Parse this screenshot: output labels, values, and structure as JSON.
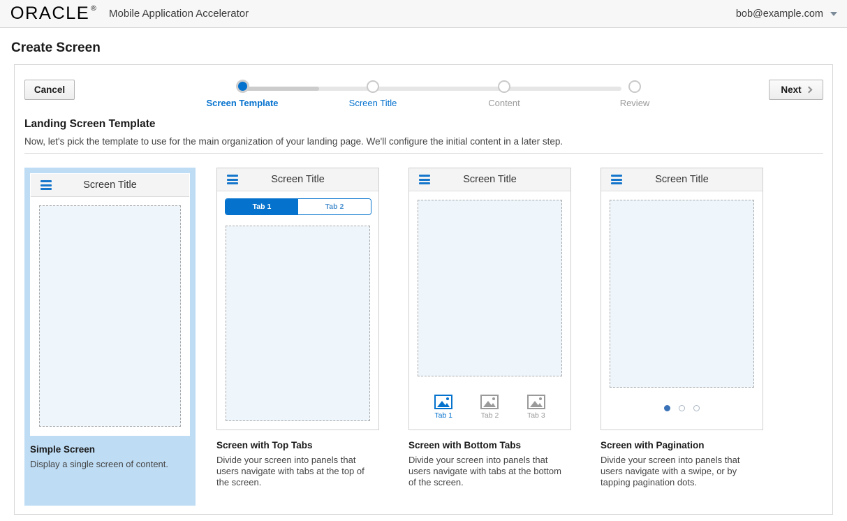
{
  "topbar": {
    "logo_text": "ORACLE",
    "logo_mark": "®",
    "app_name": "Mobile Application Accelerator",
    "user_email": "bob@example.com",
    "caret_icon": "chevron-down-icon"
  },
  "page": {
    "title": "Create Screen"
  },
  "toolbar": {
    "cancel_label": "Cancel",
    "next_label": "Next",
    "next_icon": "chevron-right-icon"
  },
  "stepper": {
    "steps": [
      {
        "label": "Screen Template",
        "state": "current"
      },
      {
        "label": "Screen Title",
        "state": "link"
      },
      {
        "label": "Content",
        "state": "disabled"
      },
      {
        "label": "Review",
        "state": "disabled"
      }
    ],
    "active_color": "#0572ce",
    "inactive_color": "#9a9a9a"
  },
  "section": {
    "heading": "Landing Screen Template",
    "description": "Now, let's pick the template to use for the main organization of your landing page. We'll configure the initial content in a later step."
  },
  "cards": [
    {
      "id": "simple-screen",
      "selected": true,
      "screen_title": "Screen Title",
      "menu_icon": "hamburger-icon",
      "title": "Simple Screen",
      "description": "Display a single screen of content."
    },
    {
      "id": "top-tabs",
      "selected": false,
      "screen_title": "Screen Title",
      "menu_icon": "hamburger-icon",
      "tabs": [
        {
          "label": "Tab 1",
          "active": true
        },
        {
          "label": "Tab 2",
          "active": false
        }
      ],
      "title": "Screen with Top Tabs",
      "description": "Divide your screen into panels that users navigate with tabs at the top of the screen."
    },
    {
      "id": "bottom-tabs",
      "selected": false,
      "screen_title": "Screen Title",
      "menu_icon": "hamburger-icon",
      "tabs": [
        {
          "label": "Tab 1",
          "active": true,
          "icon": "image-icon"
        },
        {
          "label": "Tab 2",
          "active": false,
          "icon": "image-icon"
        },
        {
          "label": "Tab 3",
          "active": false,
          "icon": "image-icon"
        }
      ],
      "title": "Screen with Bottom Tabs",
      "description": "Divide your screen into panels that users navigate with tabs at the bottom of the screen."
    },
    {
      "id": "pagination",
      "selected": false,
      "screen_title": "Screen Title",
      "menu_icon": "hamburger-icon",
      "dots": [
        {
          "active": true
        },
        {
          "active": false
        },
        {
          "active": false
        }
      ],
      "title": "Screen with Pagination",
      "description": "Divide your screen into panels that users navigate with a swipe, or by tapping pagination dots."
    }
  ],
  "colors": {
    "brand_blue": "#0572ce",
    "selected_card_bg": "#bedcf4",
    "placeholder_fill": "#eef6fc",
    "chrome_gray": "#f4f4f4"
  }
}
